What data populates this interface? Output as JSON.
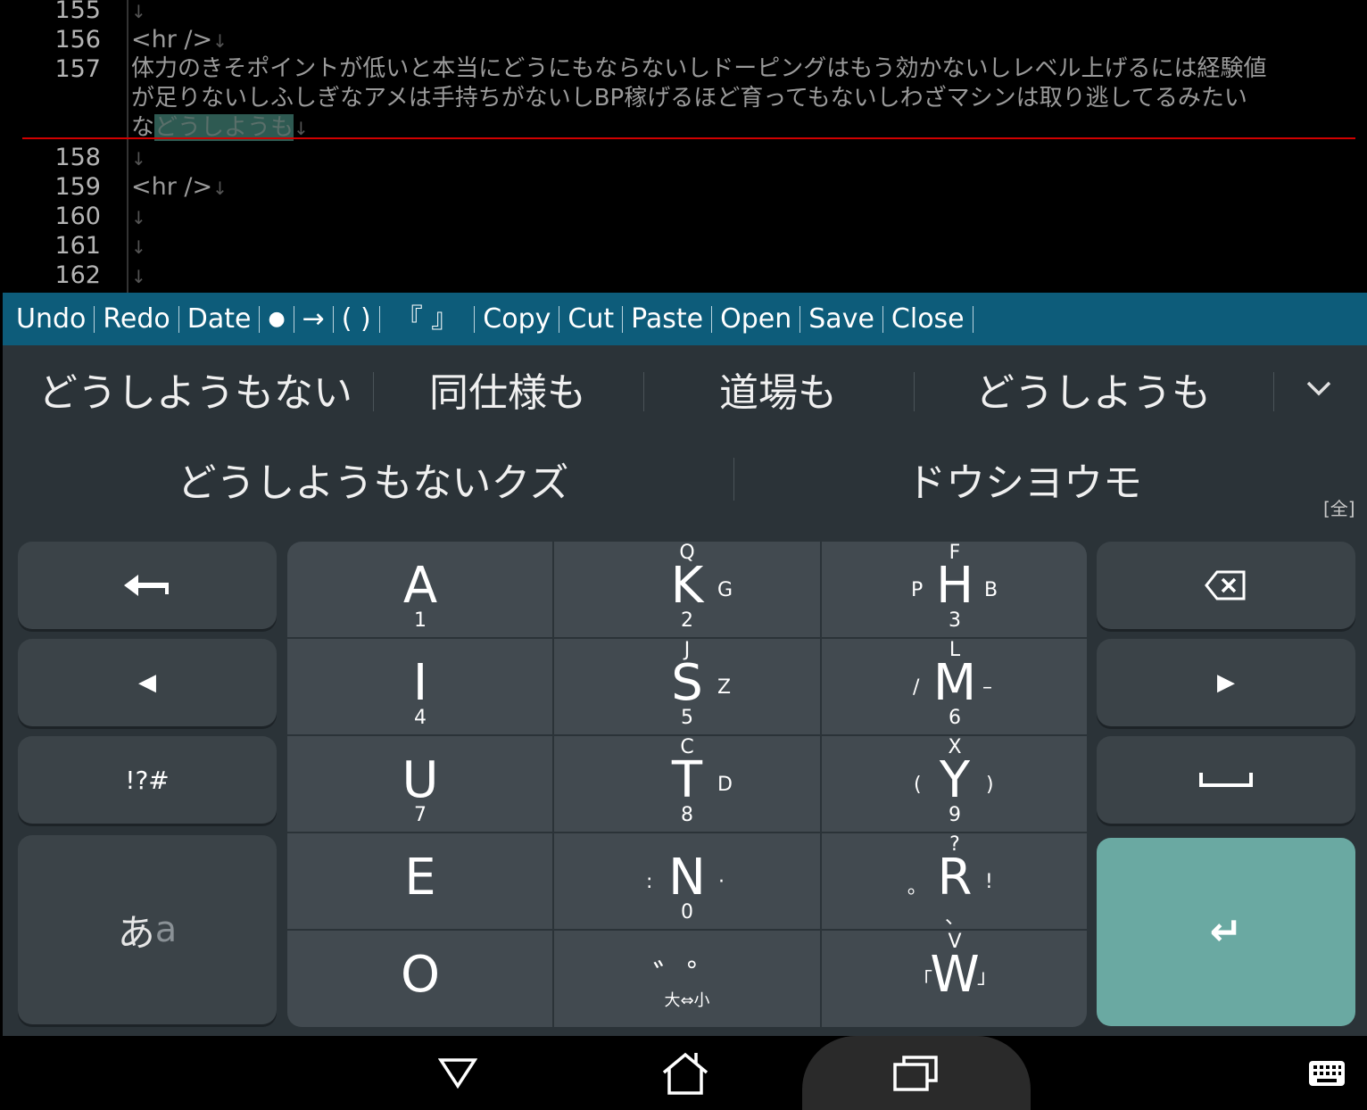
{
  "editor": {
    "lines": [
      {
        "num": "155",
        "text": ""
      },
      {
        "num": "156",
        "text": "<hr />"
      },
      {
        "num": "157",
        "text_1": "体力のきそポイントが低いと本当にどうにもならないしドーピングはもう効かないしレベル上げるには経験値",
        "text_2": "が足りないしふしぎなアメは手持ちがないしBP稼げるほど育ってもないしわざマシンは取り逃してるみたい",
        "text_3a": "な",
        "text_3_selected": "どうしようも"
      },
      {
        "num": "158",
        "text": ""
      },
      {
        "num": "159",
        "text": "<hr />"
      },
      {
        "num": "160",
        "text": ""
      },
      {
        "num": "161",
        "text": ""
      },
      {
        "num": "162",
        "text": ""
      }
    ],
    "newline_mark": "↓"
  },
  "toolbar": {
    "undo": "Undo",
    "redo": "Redo",
    "date": "Date",
    "bullet": "●",
    "arrow": "→",
    "paren": "( )",
    "bracket": "『 』",
    "copy": "Copy",
    "cut": "Cut",
    "paste": "Paste",
    "open": "Open",
    "save": "Save",
    "close": "Close"
  },
  "candidates": {
    "row1": [
      "どうしようもない",
      "同仕様も",
      "道場も",
      "どうしようも"
    ],
    "row2": [
      "どうしようもないクズ",
      "ドウシヨウモ"
    ],
    "width_mode": "[全]"
  },
  "keyboard": {
    "left": {
      "undo_arrow": "←",
      "cursor_left": "◀",
      "symbols": "!?#",
      "mode_main": "あ",
      "mode_sub": "a"
    },
    "right": {
      "backspace": "backspace-icon",
      "cursor_right": "▶",
      "space": "space-icon",
      "enter": "↵"
    },
    "keys": [
      {
        "main": "A",
        "bottom": "1"
      },
      {
        "main": "K",
        "top": "Q",
        "right": "G",
        "bottom": "2"
      },
      {
        "main": "H",
        "top": "F",
        "left": "P",
        "right": "B",
        "bottom": "3"
      },
      {
        "main": "I",
        "bottom": "4"
      },
      {
        "main": "S",
        "top": "J",
        "right": "Z",
        "bottom": "5"
      },
      {
        "main": "M",
        "top": "L",
        "left": "/",
        "right": "–",
        "bottom": "6"
      },
      {
        "main": "U",
        "bottom": "7"
      },
      {
        "main": "T",
        "top": "C",
        "right": "D",
        "bottom": "8"
      },
      {
        "main": "Y",
        "top": "X",
        "left": "(",
        "right": ")",
        "bottom": "9"
      },
      {
        "main": "E"
      },
      {
        "main": "N",
        "left": ":",
        "right": "·",
        "bottom": "0"
      },
      {
        "main": "R",
        "top": "?",
        "left": "｡",
        "right": "!",
        "bottom": "、"
      },
      {
        "main": "O"
      },
      {
        "main": "゛゜",
        "bottom": "大⇔小"
      },
      {
        "main": "W",
        "top": "V",
        "left": "「",
        "right": "」"
      }
    ]
  },
  "navbar": {
    "back": "back-icon",
    "home": "home-icon",
    "recents": "recents-icon",
    "ime": "keyboard-icon"
  }
}
